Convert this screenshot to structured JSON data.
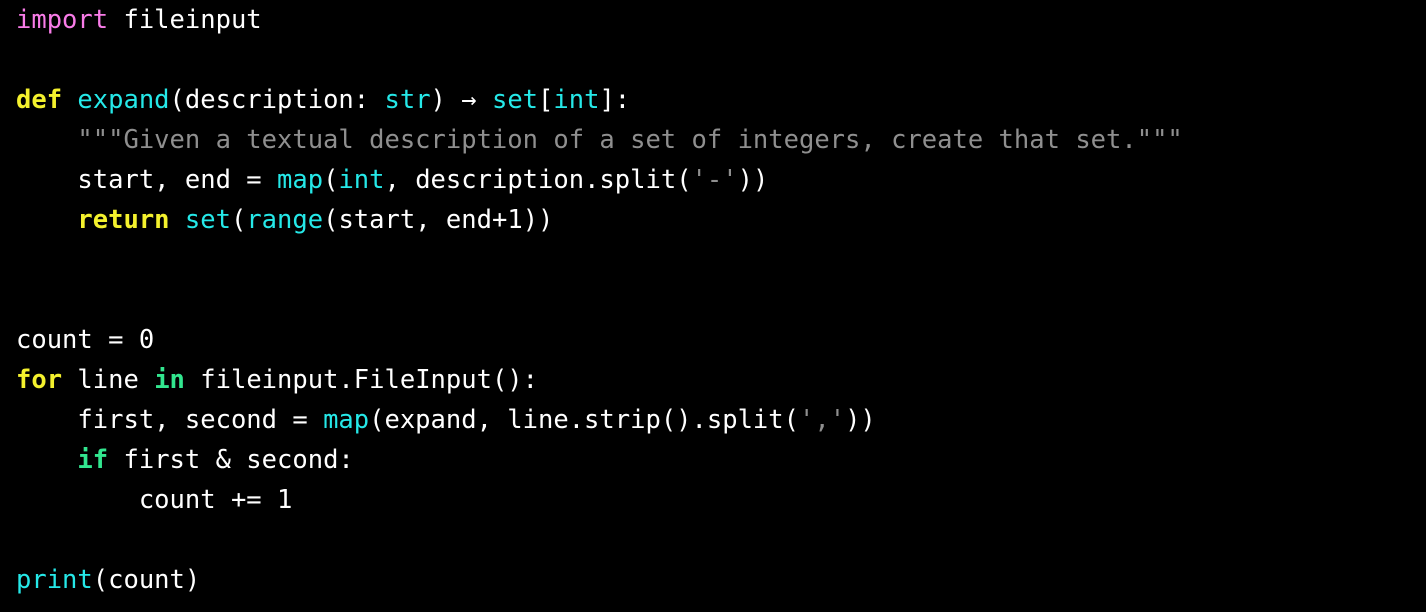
{
  "editor": {
    "background_color": "#000000",
    "default_text_color": "#ffffff",
    "language": "python",
    "line_count": 15
  },
  "theme": {
    "keyword_import_color": "#f97ce8",
    "keyword_yellow_color": "#f4f12d",
    "keyword_green_color": "#32e68f",
    "builtin_color": "#25e8e8",
    "function_color": "#25e8e8",
    "string_color": "#8f8f8f",
    "docstring_color": "#8f8f8f",
    "plain_color": "#ffffff"
  },
  "code": {
    "lines": [
      {
        "n": 1,
        "indent": "",
        "tokens": [
          {
            "t": "import",
            "c": "kw-import"
          },
          {
            "t": " fileinput",
            "c": "plain"
          }
        ]
      },
      {
        "n": 2,
        "indent": "",
        "tokens": []
      },
      {
        "n": 3,
        "indent": "",
        "tokens": [
          {
            "t": "def",
            "c": "kw-yellow"
          },
          {
            "t": " ",
            "c": "plain"
          },
          {
            "t": "expand",
            "c": "func"
          },
          {
            "t": "(description: ",
            "c": "plain"
          },
          {
            "t": "str",
            "c": "builtin"
          },
          {
            "t": ") → ",
            "c": "plain"
          },
          {
            "t": "set",
            "c": "builtin"
          },
          {
            "t": "[",
            "c": "plain"
          },
          {
            "t": "int",
            "c": "builtin"
          },
          {
            "t": "]:",
            "c": "plain"
          }
        ]
      },
      {
        "n": 4,
        "indent": "    ",
        "tokens": [
          {
            "t": "\"\"\"Given a textual description of a set of integers, create that set.\"\"\"",
            "c": "doc"
          }
        ]
      },
      {
        "n": 5,
        "indent": "    ",
        "tokens": [
          {
            "t": "start, end = ",
            "c": "plain"
          },
          {
            "t": "map",
            "c": "builtin"
          },
          {
            "t": "(",
            "c": "plain"
          },
          {
            "t": "int",
            "c": "builtin"
          },
          {
            "t": ", description.split(",
            "c": "plain"
          },
          {
            "t": "'-'",
            "c": "string"
          },
          {
            "t": "))",
            "c": "plain"
          }
        ]
      },
      {
        "n": 6,
        "indent": "    ",
        "tokens": [
          {
            "t": "return",
            "c": "kw-yellow"
          },
          {
            "t": " ",
            "c": "plain"
          },
          {
            "t": "set",
            "c": "builtin"
          },
          {
            "t": "(",
            "c": "plain"
          },
          {
            "t": "range",
            "c": "builtin"
          },
          {
            "t": "(start, end+",
            "c": "plain"
          },
          {
            "t": "1",
            "c": "num"
          },
          {
            "t": "))",
            "c": "plain"
          }
        ]
      },
      {
        "n": 7,
        "indent": "",
        "tokens": []
      },
      {
        "n": 8,
        "indent": "",
        "tokens": []
      },
      {
        "n": 9,
        "indent": "",
        "tokens": [
          {
            "t": "count = ",
            "c": "plain"
          },
          {
            "t": "0",
            "c": "num"
          }
        ]
      },
      {
        "n": 10,
        "indent": "",
        "tokens": [
          {
            "t": "for",
            "c": "kw-yellow"
          },
          {
            "t": " line ",
            "c": "plain"
          },
          {
            "t": "in",
            "c": "kw-green"
          },
          {
            "t": " fileinput.FileInput():",
            "c": "plain"
          }
        ]
      },
      {
        "n": 11,
        "indent": "    ",
        "tokens": [
          {
            "t": "first, second = ",
            "c": "plain"
          },
          {
            "t": "map",
            "c": "builtin"
          },
          {
            "t": "(expand, line.strip().split(",
            "c": "plain"
          },
          {
            "t": "','",
            "c": "string"
          },
          {
            "t": "))",
            "c": "plain"
          }
        ]
      },
      {
        "n": 12,
        "indent": "    ",
        "tokens": [
          {
            "t": "if",
            "c": "kw-green"
          },
          {
            "t": " first & second:",
            "c": "plain"
          }
        ]
      },
      {
        "n": 13,
        "indent": "        ",
        "tokens": [
          {
            "t": "count += ",
            "c": "plain"
          },
          {
            "t": "1",
            "c": "num"
          }
        ]
      },
      {
        "n": 14,
        "indent": "",
        "tokens": []
      },
      {
        "n": 15,
        "indent": "",
        "tokens": [
          {
            "t": "print",
            "c": "builtin"
          },
          {
            "t": "(count)",
            "c": "plain"
          }
        ]
      }
    ]
  }
}
